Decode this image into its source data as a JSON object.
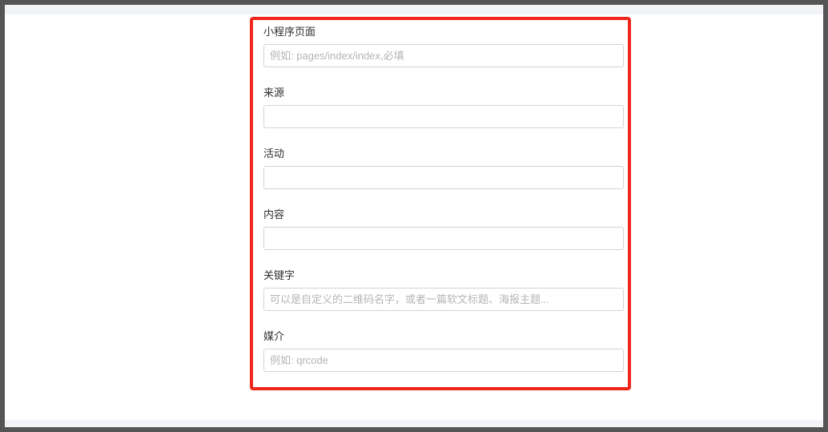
{
  "form": {
    "fields": [
      {
        "label": "小程序页面",
        "placeholder": "例如: pages/index/index,必填",
        "value": ""
      },
      {
        "label": "来源",
        "placeholder": "",
        "value": ""
      },
      {
        "label": "活动",
        "placeholder": "",
        "value": ""
      },
      {
        "label": "内容",
        "placeholder": "",
        "value": ""
      },
      {
        "label": "关键字",
        "placeholder": "可以是自定义的二维码名字，或者一篇软文标题、海报主题...",
        "value": ""
      },
      {
        "label": "媒介",
        "placeholder": "例如: qrcode",
        "value": ""
      }
    ]
  },
  "colors": {
    "frame_border": "#555555",
    "highlight_border": "#f0261c",
    "page_background": "#ffffff",
    "strip_background": "#f2f3f7"
  }
}
